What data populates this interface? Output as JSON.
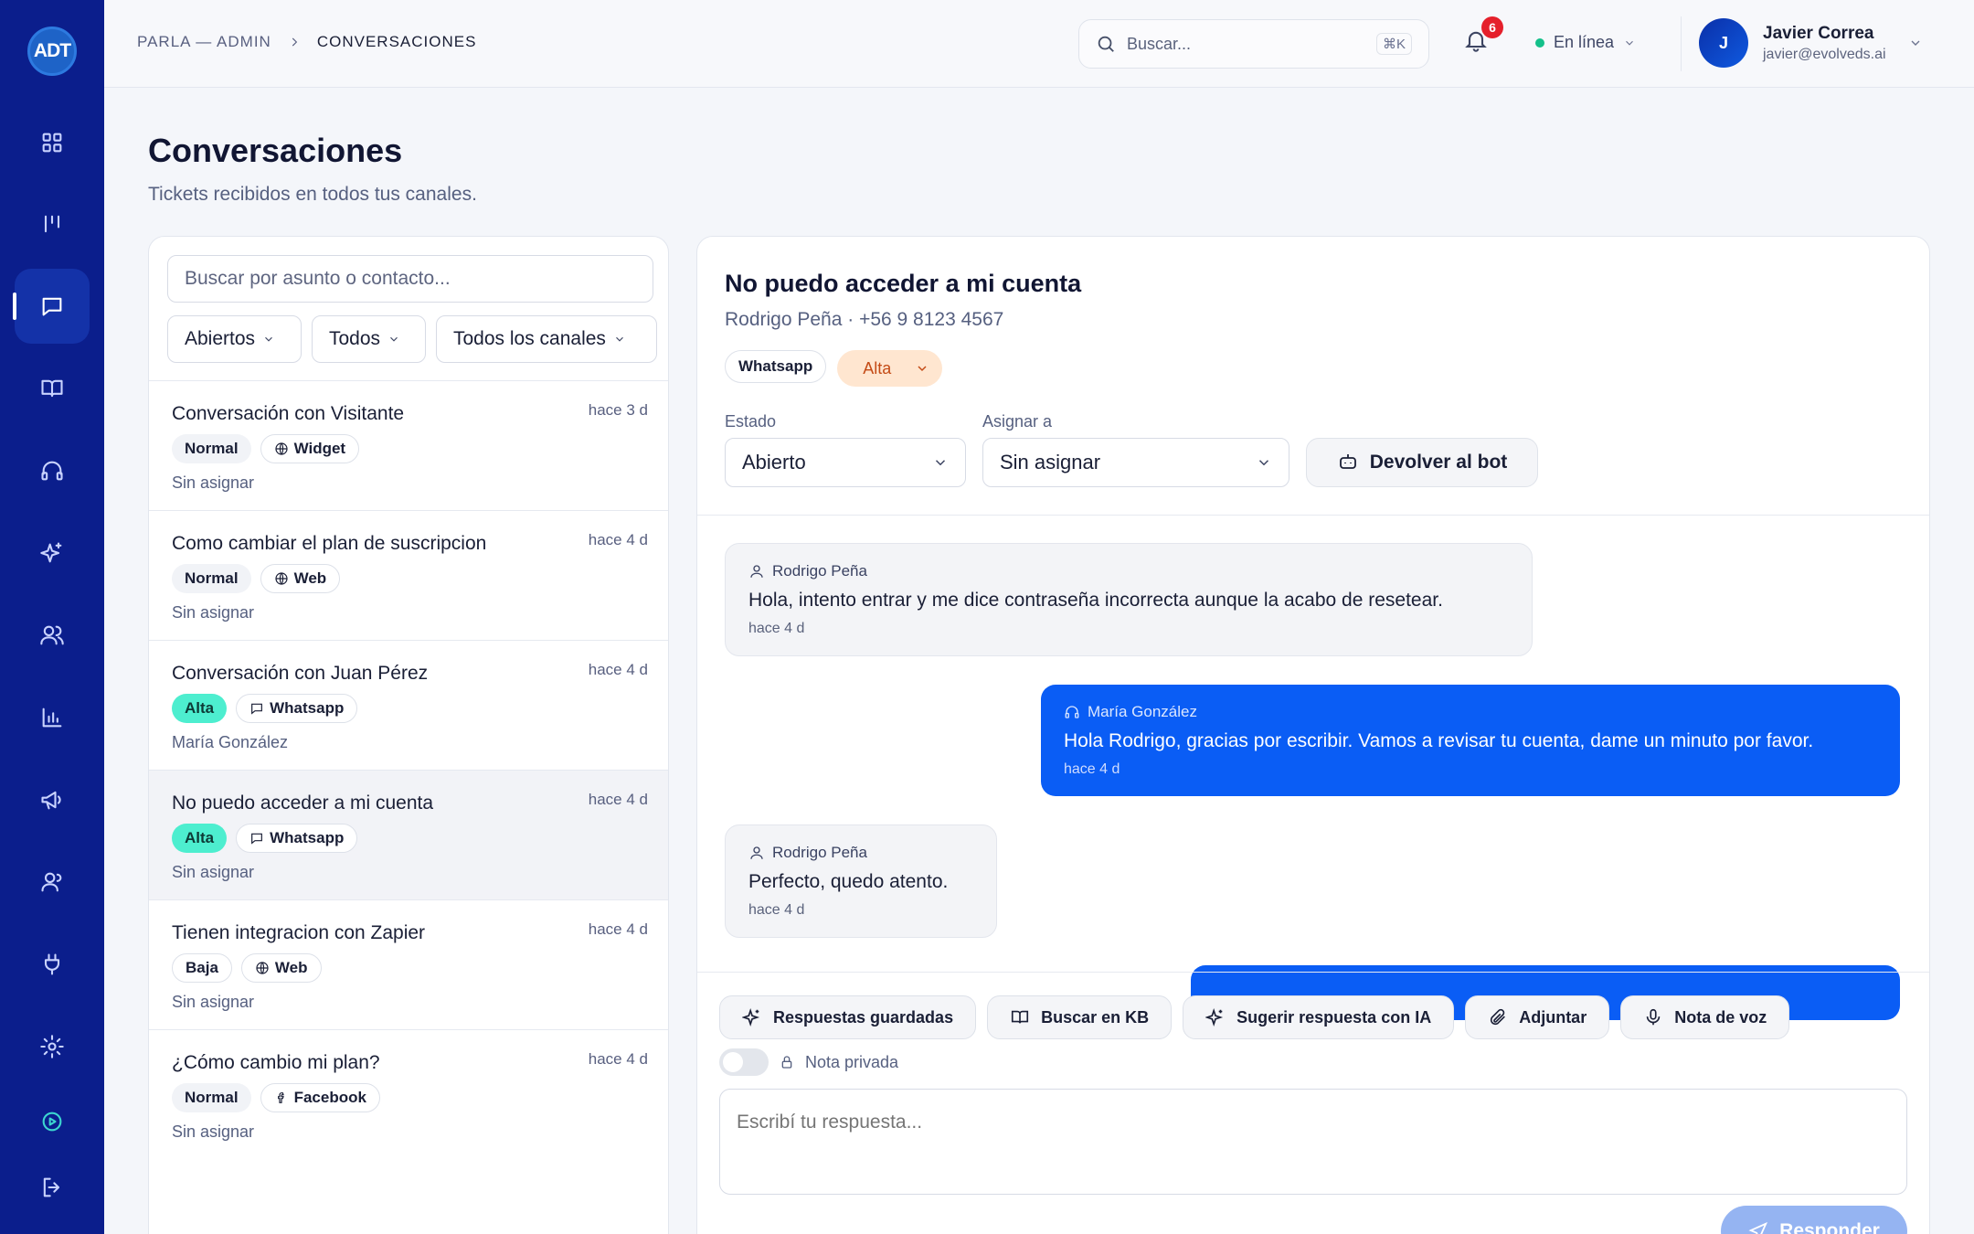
{
  "sidebar": {
    "logo": "ADT",
    "items": [
      {
        "icon": "dashboard-icon"
      },
      {
        "icon": "kanban-icon"
      },
      {
        "icon": "chat-icon",
        "active": true
      },
      {
        "icon": "book-icon"
      },
      {
        "icon": "headset-icon"
      },
      {
        "icon": "sparkle-icon"
      },
      {
        "icon": "users-icon"
      },
      {
        "icon": "chart-icon"
      },
      {
        "icon": "megaphone-icon"
      },
      {
        "icon": "team-icon"
      },
      {
        "icon": "plug-icon"
      },
      {
        "icon": "gear-icon"
      },
      {
        "icon": "play-circle-icon"
      },
      {
        "icon": "logout-icon"
      }
    ]
  },
  "topbar": {
    "breadcrumb": {
      "root": "PARLA — ADMIN",
      "current": "CONVERSACIONES"
    },
    "search_placeholder": "Buscar...",
    "search_shortcut": "⌘K",
    "notifications_count": "6",
    "status_label": "En línea",
    "user": {
      "initial": "J",
      "name": "Javier Correa",
      "email": "javier@evolveds.ai"
    }
  },
  "page": {
    "title": "Conversaciones",
    "subtitle": "Tickets recibidos en todos tus canales."
  },
  "list": {
    "search_placeholder": "Buscar por asunto o contacto...",
    "filters": {
      "status": "Abiertos",
      "assignee": "Todos",
      "channel": "Todos los canales"
    },
    "tickets": [
      {
        "title": "Conversación con Visitante",
        "time": "hace 3 d",
        "priority": "Normal",
        "channel": "Widget",
        "assignee": "Sin asignar"
      },
      {
        "title": "Como cambiar el plan de suscripcion",
        "time": "hace 4 d",
        "priority": "Normal",
        "channel": "Web",
        "assignee": "Sin asignar"
      },
      {
        "title": "Conversación con Juan Pérez",
        "time": "hace 4 d",
        "priority": "Alta",
        "channel": "Whatsapp",
        "assignee": "María González"
      },
      {
        "title": "No puedo acceder a mi cuenta",
        "time": "hace 4 d",
        "priority": "Alta",
        "channel": "Whatsapp",
        "assignee": "Sin asignar"
      },
      {
        "title": "Tienen integracion con Zapier",
        "time": "hace 4 d",
        "priority": "Baja",
        "channel": "Web",
        "assignee": "Sin asignar"
      },
      {
        "title": "¿Cómo cambio mi plan?",
        "time": "hace 4 d",
        "priority": "Normal",
        "channel": "Facebook",
        "assignee": "Sin asignar"
      }
    ]
  },
  "detail": {
    "title": "No puedo acceder a mi cuenta",
    "contact": "Rodrigo Peña · +56 9 8123 4567",
    "channel_tag": "Whatsapp",
    "priority_tag": "Alta",
    "status_label": "Estado",
    "status_value": "Abierto",
    "assign_label": "Asignar a",
    "assign_value": "Sin asignar",
    "bot_button": "Devolver al bot",
    "messages": [
      {
        "direction": "in",
        "author": "Rodrigo Peña",
        "text": "Hola, intento entrar y me dice contraseña incorrecta aunque la acabo de resetear.",
        "time": "hace 4 d"
      },
      {
        "direction": "out",
        "author": "María González",
        "text": "Hola Rodrigo, gracias por escribir. Vamos a revisar tu cuenta, dame un minuto por favor.",
        "time": "hace 4 d"
      },
      {
        "direction": "in",
        "author": "Rodrigo Peña",
        "text": "Perfecto, quedo atento.",
        "time": "hace 4 d"
      }
    ],
    "tools": [
      "Respuestas guardadas",
      "Buscar en KB",
      "Sugerir respuesta con IA",
      "Adjuntar",
      "Nota de voz"
    ],
    "private_note_label": "Nota privada",
    "reply_placeholder": "Escribí tu respuesta...",
    "send_button": "Responder"
  },
  "colors": {
    "sidebar": "#0b1e8c",
    "accent": "#0a5df5",
    "alta_tag": "#4deecf",
    "online": "#14c08a"
  }
}
